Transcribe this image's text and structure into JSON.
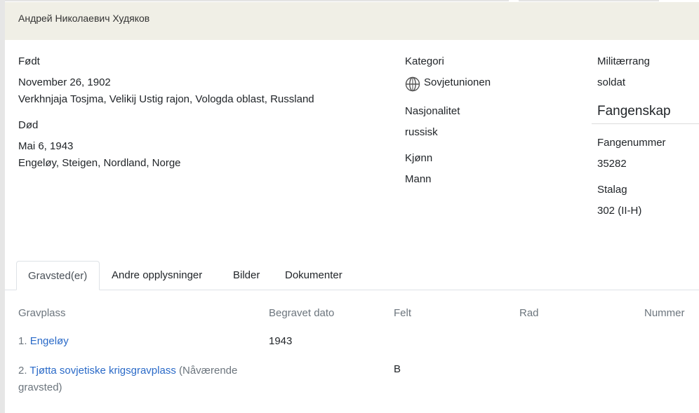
{
  "person": {
    "name": "Андрей Николаевич Худяков"
  },
  "born": {
    "label": "Født",
    "date": "November 26, 1902",
    "place": "Verkhnjaja Tosjma, Velikij Ustig rajon, Vologda oblast, Russland"
  },
  "died": {
    "label": "Død",
    "date": "Mai 6, 1943",
    "place": "Engeløy, Steigen, Nordland, Norge"
  },
  "category": {
    "label": "Kategori",
    "value": "Sovjetunionen",
    "icon": "globe-icon"
  },
  "nationality": {
    "label": "Nasjonalitet",
    "value": "russisk"
  },
  "gender": {
    "label": "Kjønn",
    "value": "Mann"
  },
  "military": {
    "label": "Militærrang",
    "value": "soldat"
  },
  "captivity": {
    "heading": "Fangenskap",
    "number_label": "Fangenummer",
    "number_value": "35282",
    "stalag_label": "Stalag",
    "stalag_value": "302 (II-H)"
  },
  "tabs": [
    {
      "label": "Gravsted(er)",
      "active": true
    },
    {
      "label": "Andre opplysninger"
    },
    {
      "label": "Bilder"
    },
    {
      "label": "Dokumenter"
    }
  ],
  "graves_table": {
    "headers": [
      "Gravplass",
      "Begravet dato",
      "Felt",
      "Rad",
      "Nummer"
    ],
    "rows": [
      {
        "index": "1.",
        "place": "Engeløy",
        "note": "",
        "date": "1943",
        "field": "",
        "row": "",
        "number": ""
      },
      {
        "index": "2.",
        "place": "Tjøtta sovjetiske krigsgravplass",
        "note_line1": "(Nåværende",
        "note_line2": "gravsted)",
        "date": "",
        "field": "B",
        "row": "",
        "number": ""
      }
    ]
  }
}
